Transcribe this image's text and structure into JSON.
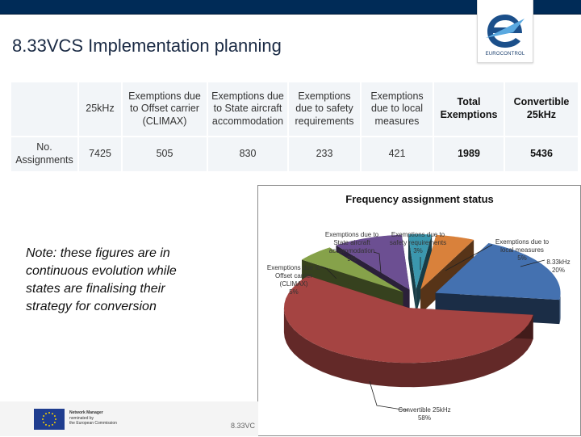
{
  "header": {
    "title": "8.33VCS Implementation planning",
    "logo_text": "EUROCONTROL",
    "brand_color": "#002b57"
  },
  "table": {
    "headers": [
      "",
      "25kHz",
      "Exemptions due to Offset carrier (CLIMAX)",
      "Exemptions due to State aircraft accommodation",
      "Exemptions due to safety requirements",
      "Exemptions due to local measures",
      "Total Exemptions",
      "Convertible 25kHz"
    ],
    "rows": [
      {
        "label": "No. Assignments",
        "values": [
          "7425",
          "505",
          "830",
          "233",
          "421",
          "1989",
          "5436"
        ]
      }
    ]
  },
  "note": "Note: these figures are in continuous evolution while states are finalising their strategy for conversion",
  "footer": {
    "eu_line1": "Network Manager",
    "eu_line2": "nominated by",
    "eu_line3": "the European Commission",
    "label": "8.33VC"
  },
  "chart_data": {
    "type": "pie",
    "title": "Frequency assignment status",
    "exploded": true,
    "three_d": true,
    "slices": [
      {
        "label": "8.33kHz",
        "percent": 20,
        "color": "#4471b0"
      },
      {
        "label": "Convertible 25kHz",
        "percent": 58,
        "color": "#a54442"
      },
      {
        "label": "Exemptions due to Offset carrier (CLIMAX)",
        "percent": 5,
        "color": "#86a24a"
      },
      {
        "label": "Exemptions due to State aircraft accommodation",
        "percent": 9,
        "color": "#6c4f92"
      },
      {
        "label": "Exemptions due to safety requirements",
        "percent": 3,
        "color": "#3b97ae"
      },
      {
        "label": "Exemptions due to local measures",
        "percent": 5,
        "color": "#d9813b"
      }
    ],
    "labels": {
      "s833": [
        "8.33kHz",
        "20%"
      ],
      "conv": [
        "Convertible 25kHz",
        "58%"
      ],
      "climax": [
        "Exemptions due to",
        "Offset carrier",
        "(CLIMAX)",
        "5%"
      ],
      "state": [
        "Exemptions due to",
        "State aircraft",
        "accommodation",
        "9%"
      ],
      "safety": [
        "Exemptions due to",
        "safety requirements",
        "3%"
      ],
      "local": [
        "Exemptions due to",
        "local measures",
        "5%"
      ]
    }
  }
}
